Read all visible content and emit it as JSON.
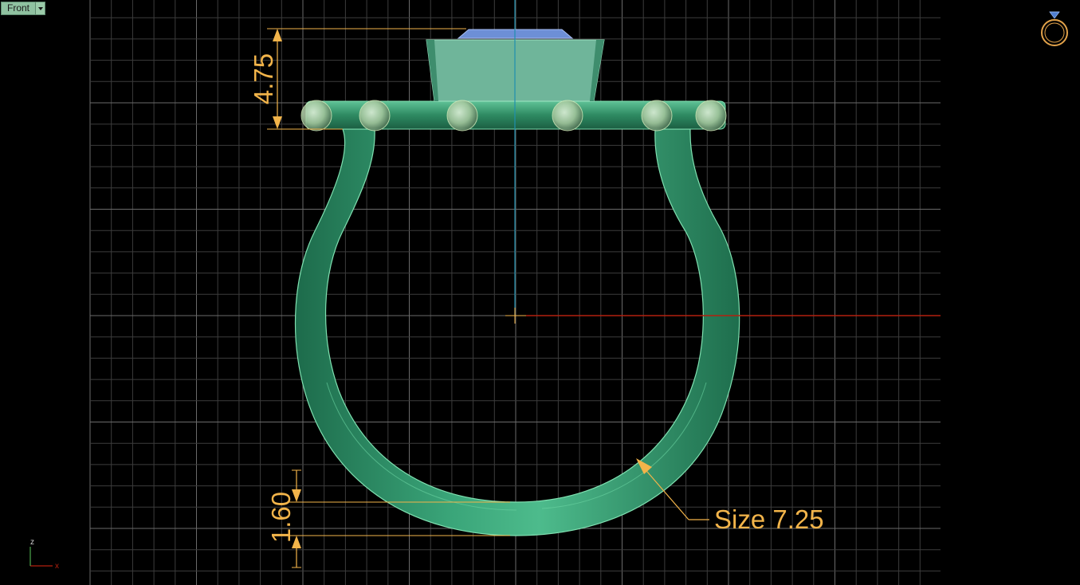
{
  "viewport": {
    "view_name": "Front",
    "axis_labels": {
      "x": "x",
      "z": "z"
    }
  },
  "dimensions": {
    "top_height": "4.75",
    "band_thickness": "1.60",
    "size_label": "Size 7.25"
  },
  "colors": {
    "background": "#000000",
    "grid": "#4d4d4d",
    "ring": "#2e8a62",
    "ring_edge": "#7fe0b0",
    "dimension": "#f2b44a",
    "x_axis": "#b3210f",
    "y_axis": "#1f8fae",
    "gem": "#6d8fd6"
  },
  "icons": {
    "orientation_widget": "ring-icon"
  }
}
